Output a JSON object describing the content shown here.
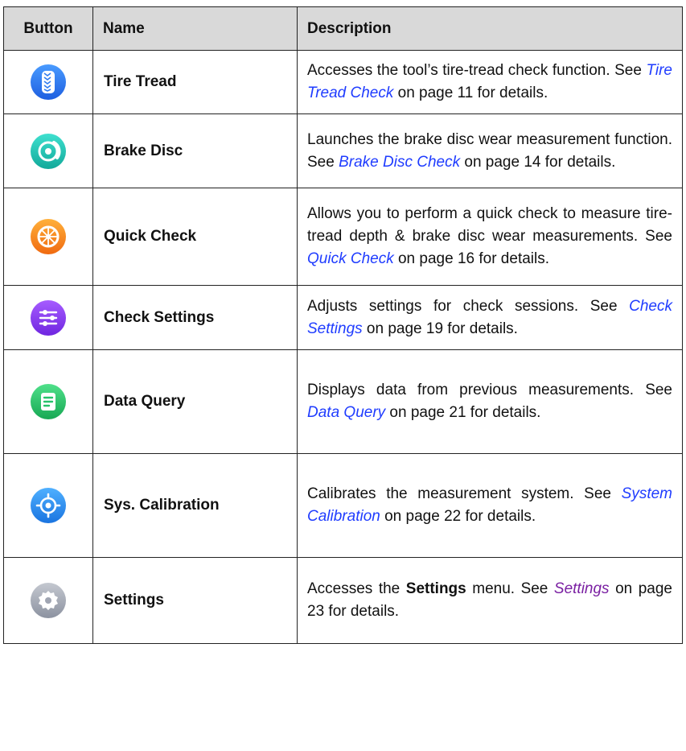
{
  "headers": {
    "button": "Button",
    "name": "Name",
    "description": "Description"
  },
  "rows": [
    {
      "icon": "tire-tread-icon",
      "name": "Tire Tread",
      "desc": {
        "a": "Accesses the tool’s tire-tread check function. See ",
        "link": "Tire Tread Check",
        "b": " on page 11 for details."
      }
    },
    {
      "icon": "brake-disc-icon",
      "name": "Brake Disc",
      "desc": {
        "a": "Launches the brake disc wear measurement function. See ",
        "link": "Brake Disc Check",
        "b": " on page 14 for details."
      }
    },
    {
      "icon": "quick-check-icon",
      "name": "Quick Check",
      "desc": {
        "a": "Allows you to perform a quick check to measure tire-tread depth & brake disc wear measurements. See ",
        "link": "Quick Check",
        "b": " on page 16 for details."
      }
    },
    {
      "icon": "check-settings-icon",
      "name": "Check Settings",
      "desc": {
        "a": "Adjusts settings for check sessions. See ",
        "link": "Check Settings",
        "b": " on page 19 for details."
      }
    },
    {
      "icon": "data-query-icon",
      "name": "Data Query",
      "desc": {
        "a": "Displays data from previous measurements. See ",
        "link": "Data Query",
        "b": " on page 21 for details."
      }
    },
    {
      "icon": "sys-calibration-icon",
      "name": "Sys. Calibration",
      "desc": {
        "a": "Calibrates the measurement system. See ",
        "link": "System Calibration",
        "b": " on page 22 for details."
      }
    },
    {
      "icon": "settings-gear-icon",
      "name": "Settings",
      "desc": {
        "a": "Accesses the ",
        "bold": "Settings",
        "a2": " menu. See ",
        "link": "Settings",
        "b": " on page 23 for details."
      }
    }
  ],
  "colors": {
    "link": "#1f3cff",
    "link_visited": "#7a1fa2",
    "header_bg": "#d9d9d9",
    "icon_tire": "#2f7bf0",
    "icon_brake": "#1fc7b8",
    "icon_quick": "#f58a1c",
    "icon_check_settings": "#8a3ff0",
    "icon_data_query": "#27c26a",
    "icon_calibration": "#2b8ef2",
    "icon_settings": "#a8adb8"
  }
}
